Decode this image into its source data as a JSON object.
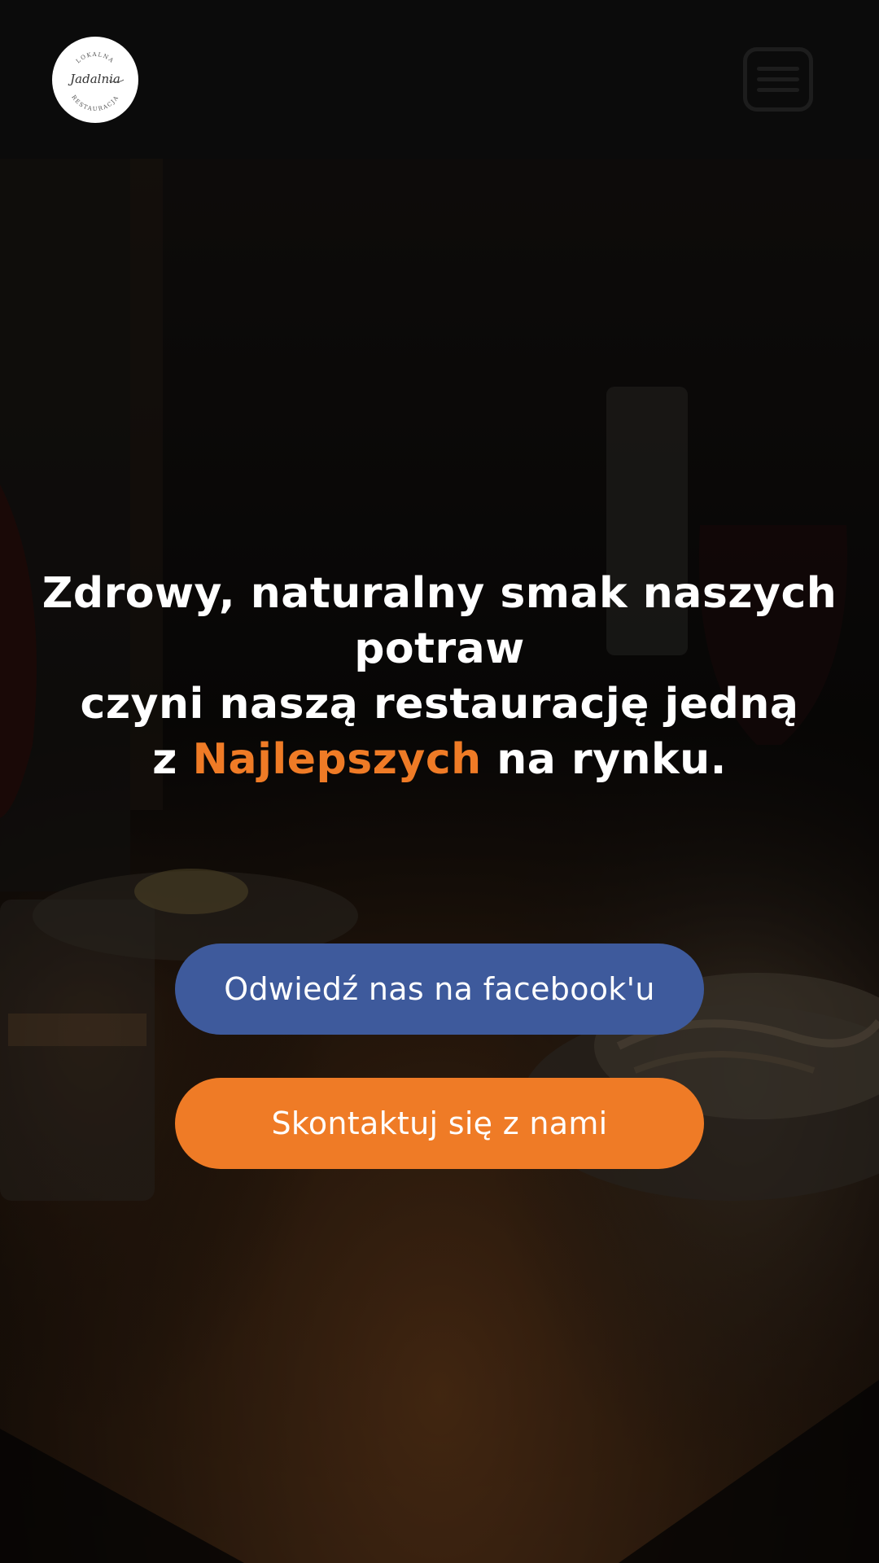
{
  "header": {
    "logo": {
      "top_text": "LOKALNA",
      "script_text": "Jadalnia",
      "bottom_text": "RESTAURACJA"
    },
    "menu_icon": "hamburger-menu-icon"
  },
  "hero": {
    "headline": {
      "line1": "Zdrowy, naturalny smak naszych potraw",
      "line2": "czyni naszą restaurację jedną",
      "line3_prefix": "z ",
      "line3_accent": "Najlepszych",
      "line3_suffix": " na rynku."
    },
    "buttons": {
      "facebook": "Odwiedź nas na facebook'u",
      "contact": "Skontaktuj się z nami"
    }
  },
  "colors": {
    "accent": "#ef7b26",
    "facebook": "#3e5a9c",
    "header_bg": "#0b0b0b"
  }
}
